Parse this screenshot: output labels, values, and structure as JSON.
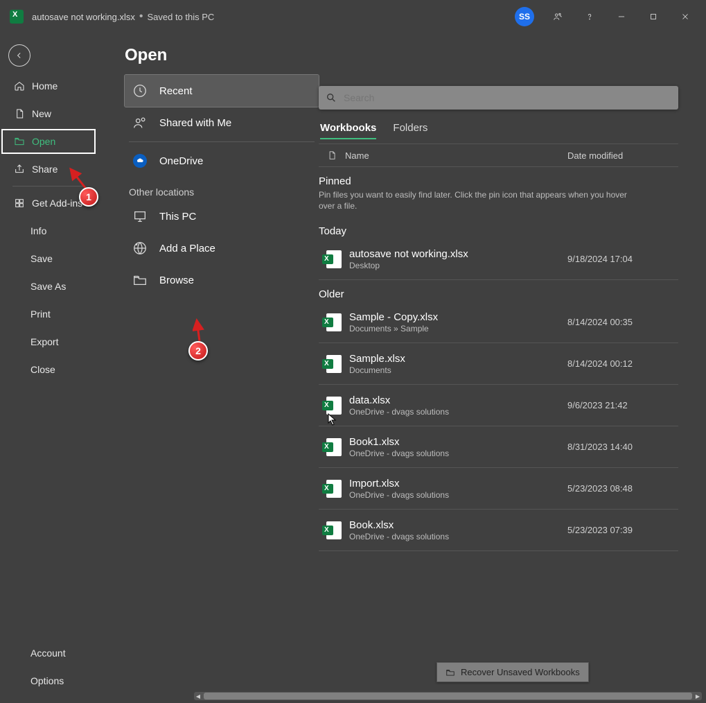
{
  "titlebar": {
    "filename": "autosave not working.xlsx",
    "save_status": "Saved to this PC",
    "avatar_initials": "SS"
  },
  "nav": {
    "home": "Home",
    "new": "New",
    "open": "Open",
    "share": "Share",
    "get_addins": "Get Add-ins",
    "info": "Info",
    "save": "Save",
    "save_as": "Save As",
    "print": "Print",
    "export": "Export",
    "close": "Close",
    "account": "Account",
    "options": "Options"
  },
  "page": {
    "title": "Open"
  },
  "locations": {
    "recent": "Recent",
    "shared": "Shared with Me",
    "onedrive": "OneDrive",
    "other_heading": "Other locations",
    "this_pc": "This PC",
    "add_place": "Add a Place",
    "browse": "Browse"
  },
  "search": {
    "placeholder": "Search"
  },
  "tabs": {
    "workbooks": "Workbooks",
    "folders": "Folders"
  },
  "list_header": {
    "name": "Name",
    "date": "Date modified"
  },
  "sections": {
    "pinned": "Pinned",
    "pinned_hint": "Pin files you want to easily find later. Click the pin icon that appears when you hover over a file.",
    "today": "Today",
    "older": "Older"
  },
  "files": {
    "today": [
      {
        "name": "autosave not working.xlsx",
        "loc": "Desktop",
        "date": "9/18/2024 17:04"
      }
    ],
    "older": [
      {
        "name": "Sample - Copy.xlsx",
        "loc": "Documents » Sample",
        "date": "8/14/2024 00:35"
      },
      {
        "name": "Sample.xlsx",
        "loc": "Documents",
        "date": "8/14/2024 00:12"
      },
      {
        "name": "data.xlsx",
        "loc": "OneDrive - dvags solutions",
        "date": "9/6/2023 21:42"
      },
      {
        "name": "Book1.xlsx",
        "loc": "OneDrive - dvags solutions",
        "date": "8/31/2023 14:40"
      },
      {
        "name": "Import.xlsx",
        "loc": "OneDrive - dvags solutions",
        "date": "5/23/2023 08:48"
      },
      {
        "name": "Book.xlsx",
        "loc": "OneDrive - dvags solutions",
        "date": "5/23/2023 07:39"
      }
    ]
  },
  "recover_btn": "Recover Unsaved Workbooks",
  "annotations": {
    "c1": "1",
    "c2": "2"
  }
}
